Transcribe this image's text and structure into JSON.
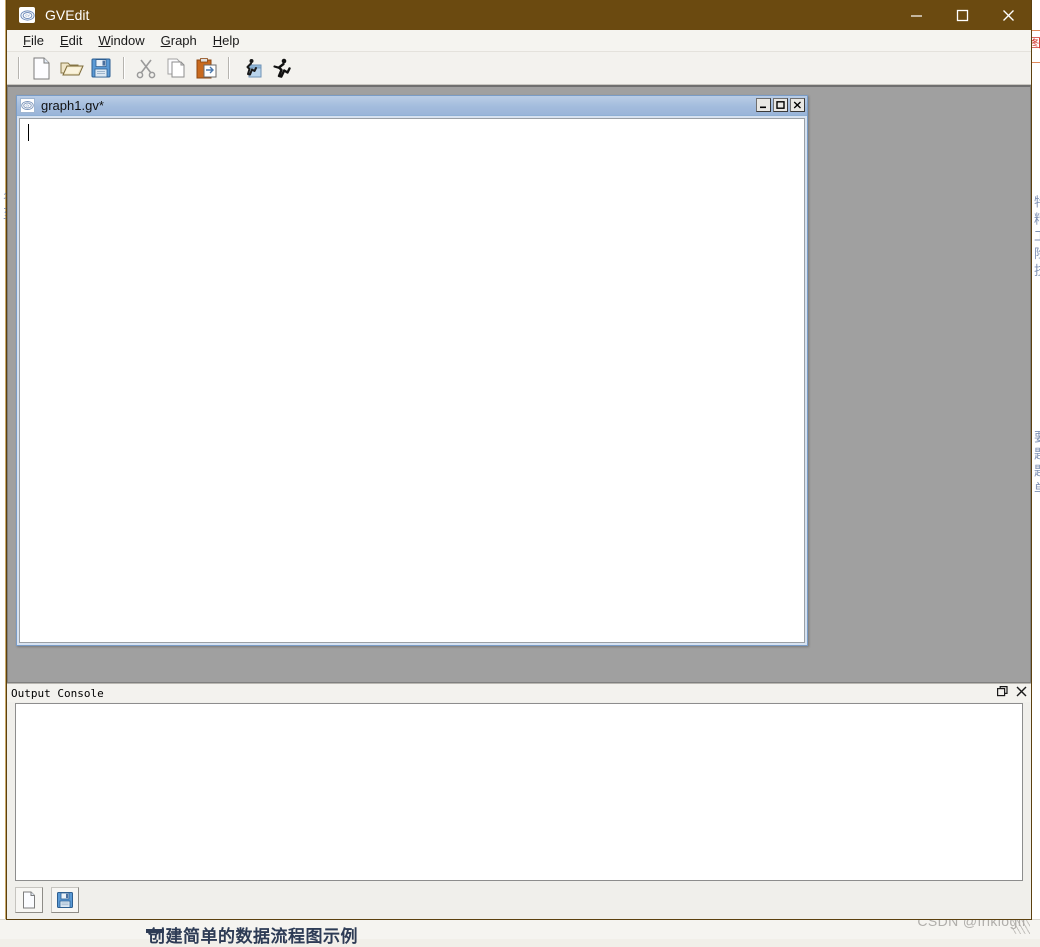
{
  "background": {
    "right_red_mark": "图",
    "left_vertical_text": "名  至",
    "right_vertical_text": "特  精  工  险  技",
    "right_vertical_text2": "要  题  题  单",
    "bottom_heading": "创建简单的数据流程图示例",
    "watermark": "CSDN @friklogff"
  },
  "window": {
    "title": "GVEdit",
    "icon": "graphviz-icon",
    "controls": {
      "minimize": "minimize-icon",
      "maximize": "maximize-icon",
      "close": "close-icon"
    }
  },
  "menubar": {
    "items": [
      {
        "mnemonic": "F",
        "rest": "ile",
        "name": "file"
      },
      {
        "mnemonic": "E",
        "rest": "dit",
        "name": "edit"
      },
      {
        "mnemonic": "W",
        "rest": "indow",
        "name": "window"
      },
      {
        "mnemonic": "G",
        "rest": "raph",
        "name": "graph"
      },
      {
        "mnemonic": "H",
        "rest": "elp",
        "name": "help"
      }
    ]
  },
  "toolbar": {
    "buttons": [
      {
        "name": "new-file-button",
        "icon": "new-document-icon",
        "label": "New"
      },
      {
        "name": "open-file-button",
        "icon": "open-folder-icon",
        "label": "Open"
      },
      {
        "name": "save-file-button",
        "icon": "floppy-save-icon",
        "label": "Save"
      },
      {
        "name": "cut-button",
        "icon": "scissors-icon",
        "label": "Cut"
      },
      {
        "name": "copy-button",
        "icon": "copy-pages-icon",
        "label": "Copy"
      },
      {
        "name": "paste-button",
        "icon": "paste-clipboard-icon",
        "label": "Paste"
      },
      {
        "name": "layout-button",
        "icon": "running-man-window-icon",
        "label": "Layout"
      },
      {
        "name": "run-button",
        "icon": "running-man-icon",
        "label": "Run"
      }
    ]
  },
  "mdi_child": {
    "title": "graph1.gv*",
    "icon": "graphviz-icon",
    "editor_text": "",
    "controls": {
      "minimize": "minimize-icon",
      "maximize": "maximize-icon",
      "close": "close-icon"
    }
  },
  "console": {
    "title": "Output Console",
    "text": "",
    "float_icon": "undock-icon",
    "close_icon": "close-icon"
  },
  "bottom_toolbar": {
    "buttons": [
      {
        "name": "console-new-button",
        "icon": "new-document-icon",
        "label": "New"
      },
      {
        "name": "console-save-button",
        "icon": "floppy-save-icon",
        "label": "Save"
      }
    ]
  }
}
